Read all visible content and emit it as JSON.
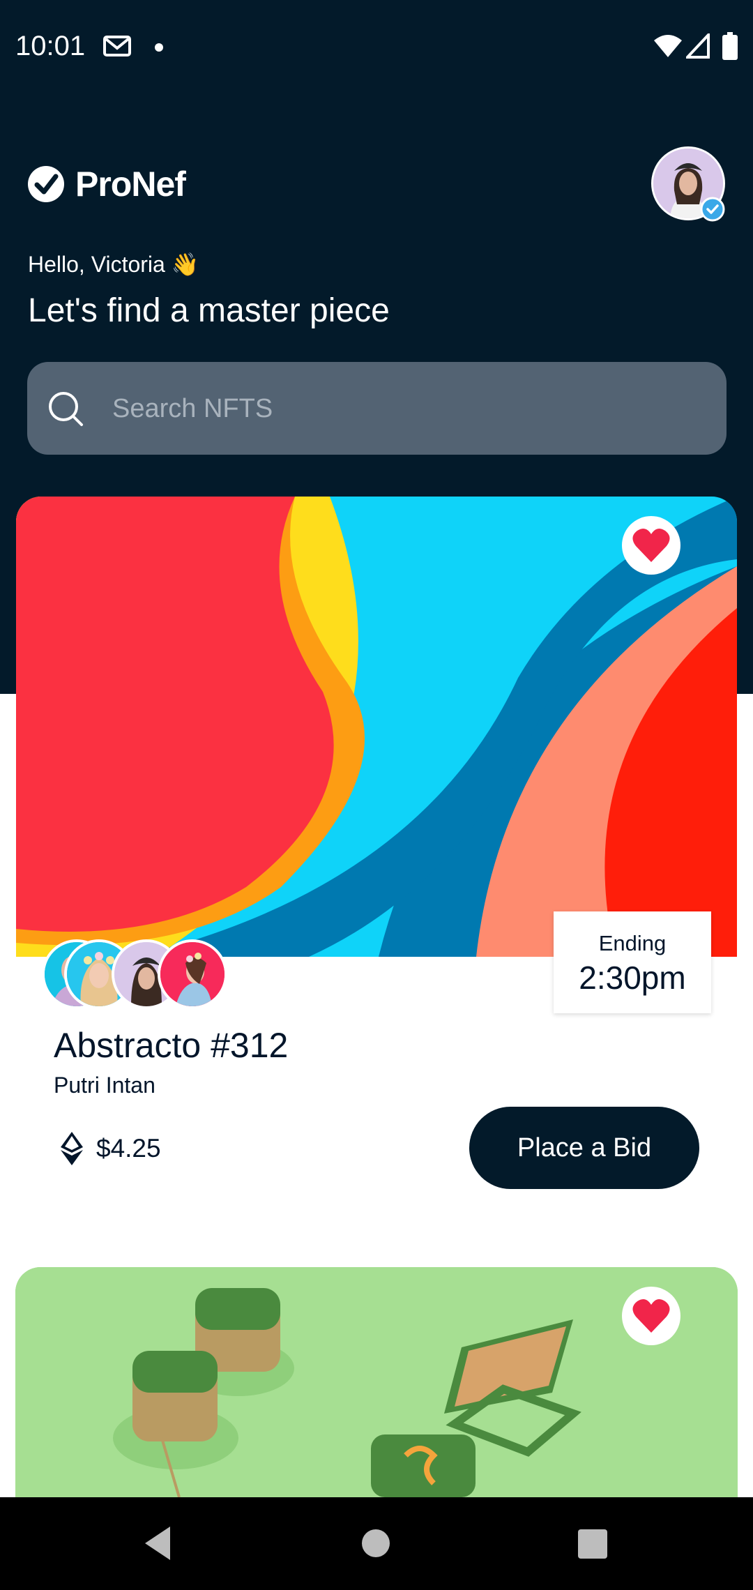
{
  "status_bar": {
    "time": "10:01"
  },
  "app": {
    "name": "ProNef"
  },
  "header": {
    "greeting": "Hello, Victoria 👋",
    "headline": "Let's find a master piece"
  },
  "search": {
    "placeholder": "Search NFTS"
  },
  "cards": [
    {
      "title": "Abstracto #312",
      "artist": "Putri Intan",
      "price": "$4.25",
      "ending_label": "Ending",
      "ending_time": "2:30pm",
      "bid_label": "Place a Bid",
      "liked": true
    },
    {
      "liked": true
    }
  ],
  "colors": {
    "navy": "#031a2a",
    "search_bg": "#536373",
    "heart": "#f1254a",
    "verified": "#3aa8e8"
  }
}
